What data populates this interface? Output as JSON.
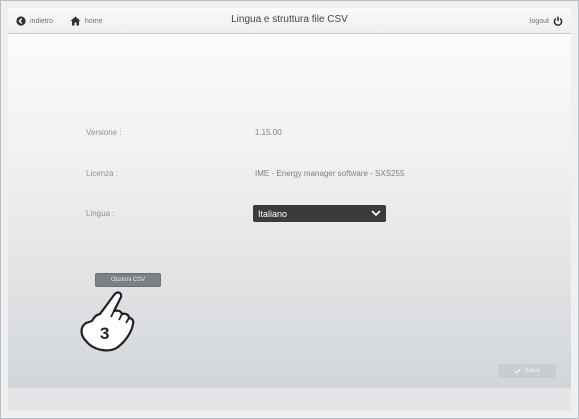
{
  "header": {
    "back_label": "indietro",
    "home_label": "home",
    "title": "Lingua e struttura file CSV",
    "logout_label": "logout"
  },
  "info": {
    "version_label": "Versione :",
    "version_value": "1.15.00",
    "license_label": "Licenza :",
    "license_value": "IME - Energy manager software - SXS255",
    "language_label": "Lingua :",
    "language_selected": "Italiano"
  },
  "actions": {
    "csv_options_label": "Opzioni CSV",
    "save_label": "Salva"
  },
  "callout": {
    "step_number": "3"
  },
  "colors": {
    "select_bg": "#3a3b3d",
    "csv_button_bg": "#7c8084",
    "save_button_bg": "#c8cdd1"
  }
}
